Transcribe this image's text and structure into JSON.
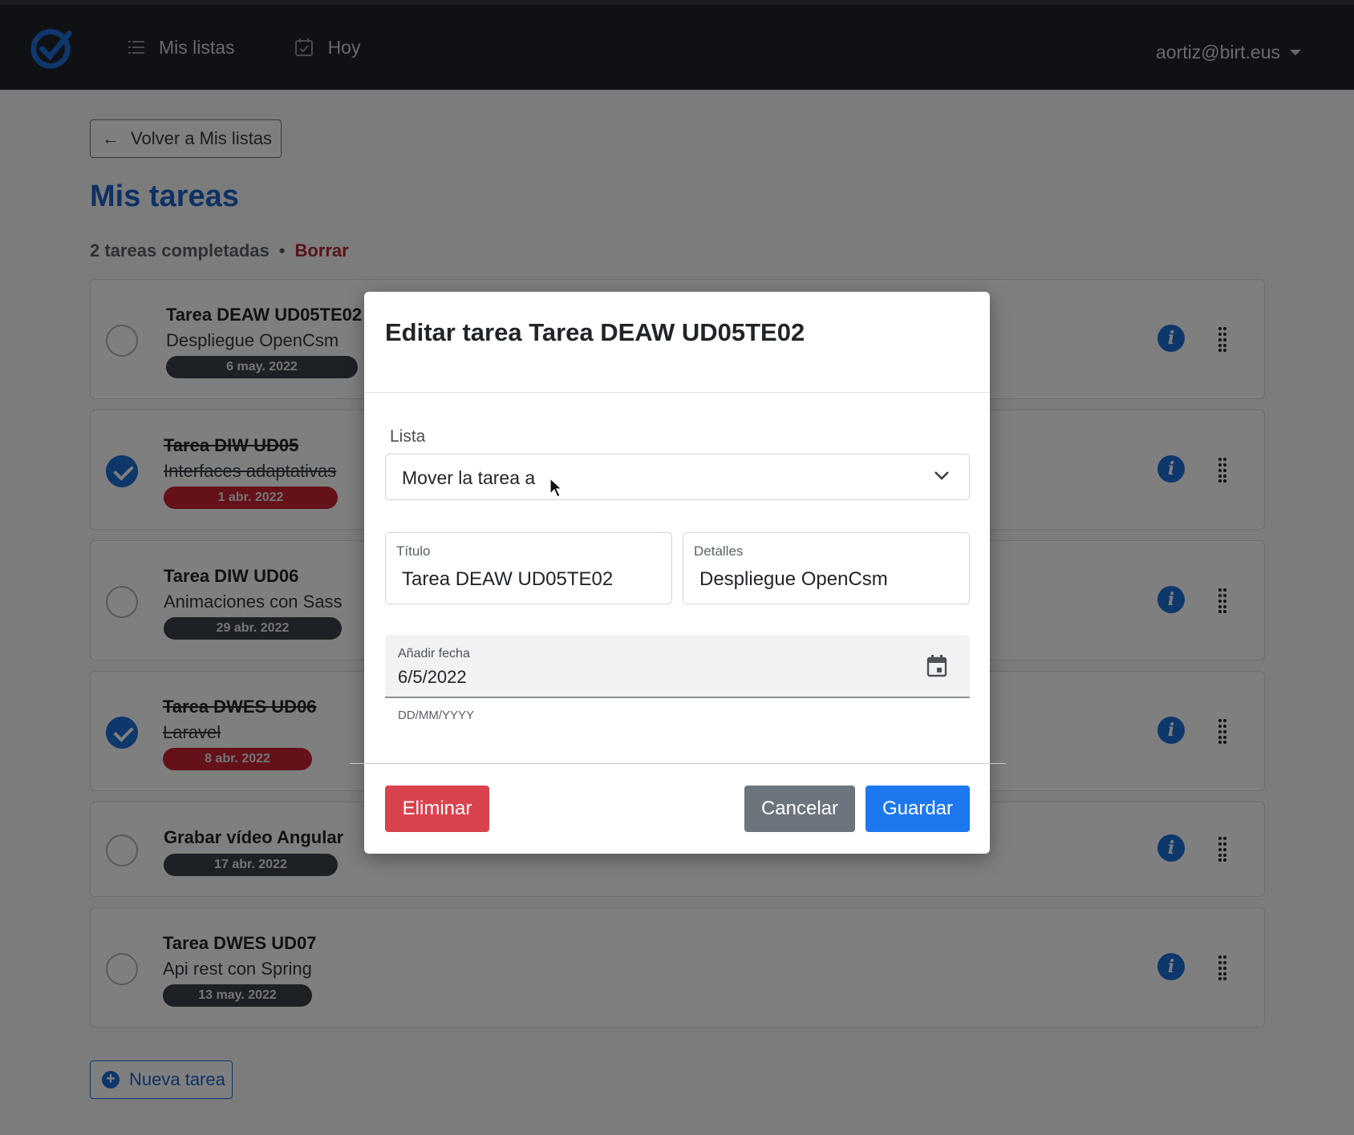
{
  "navbar": {
    "nav_items": [
      {
        "label": "Mis listas",
        "icon": "list-icon"
      },
      {
        "label": "Hoy",
        "icon": "calendar-check-icon"
      }
    ],
    "user_email": "aortiz@birt.eus"
  },
  "page": {
    "back_label": "Volver a Mis listas",
    "title": "Mis tareas",
    "completed_summary": "2 tareas completadas",
    "separator": "•",
    "clear_label": "Borrar",
    "new_task_label": "Nueva tarea"
  },
  "tasks": [
    {
      "title": "Tarea DEAW UD05TE02",
      "details": "Despliegue OpenCsm",
      "date": "6 may. 2022",
      "completed": false,
      "overdue": false
    },
    {
      "title": "Tarea DIW UD05",
      "details": "Interfaces adaptativas",
      "date": "1 abr. 2022",
      "completed": true,
      "overdue": true
    },
    {
      "title": "Tarea DIW UD06",
      "details": "Animaciones con Sass",
      "date": "29 abr. 2022",
      "completed": false,
      "overdue": false
    },
    {
      "title": "Tarea DWES UD06",
      "details": "Laravel",
      "date": "8 abr. 2022",
      "completed": true,
      "overdue": true
    },
    {
      "title": "Grabar vídeo Angular",
      "details": "",
      "date": "17 abr. 2022",
      "completed": false,
      "overdue": false
    },
    {
      "title": "Tarea DWES UD07",
      "details": "Api rest con Spring",
      "date": "13 may. 2022",
      "completed": false,
      "overdue": false
    }
  ],
  "modal": {
    "title": "Editar tarea Tarea DEAW UD05TE02",
    "list_label": "Lista",
    "list_select_value": "Mover la tarea a",
    "title_field_label": "Título",
    "title_field_value": "Tarea DEAW UD05TE02",
    "details_field_label": "Detalles",
    "details_field_value": "Despliegue OpenCsm",
    "date_label": "Añadir fecha",
    "date_value": "6/5/2022",
    "date_hint": "DD/MM/YYYY",
    "delete_label": "Eliminar",
    "cancel_label": "Cancelar",
    "save_label": "Guardar"
  },
  "colors": {
    "accent": "#1d6fd6",
    "danger": "#d9434d",
    "navbar": "#20232a"
  }
}
